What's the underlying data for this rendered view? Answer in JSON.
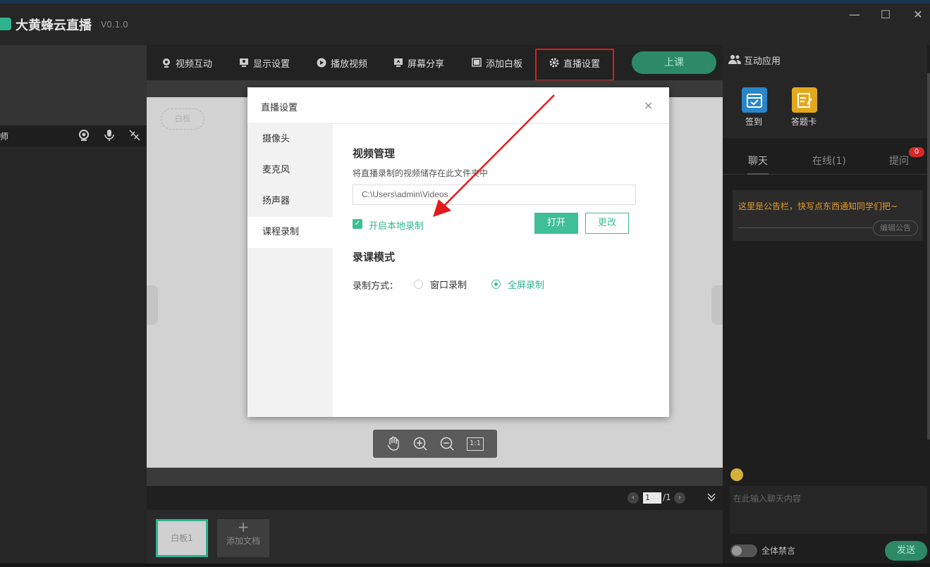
{
  "window": {
    "title": "大黄蜂云直播",
    "version": "V0.1.0",
    "minimize": "—",
    "maximize": "☐",
    "close": "✕"
  },
  "left_panel": {
    "teacher_label": "师"
  },
  "toolbar": {
    "video_interact": "视频互动",
    "display_settings": "显示设置",
    "play_video": "播放视频",
    "screen_share": "屏幕分享",
    "add_whiteboard": "添加白板",
    "live_settings": "直播设置",
    "start_class": "上课"
  },
  "canvas": {
    "whiteboard_tag": "白板",
    "zoom_fit": "1:1"
  },
  "pager": {
    "current": "1",
    "total": "/1"
  },
  "docs": {
    "whiteboard_thumb": "白板1",
    "add_doc_plus": "+",
    "add_doc": "添加文档"
  },
  "right_panel": {
    "apps_title": "互动应用",
    "apps": [
      {
        "label": "签到"
      },
      {
        "label": "答题卡"
      }
    ],
    "tabs": [
      {
        "label": "聊天"
      },
      {
        "label": "在线(1)"
      },
      {
        "label": "提问"
      }
    ],
    "question_badge": "0",
    "notice": "这里是公告栏，快写点东西通知同学们把~",
    "edit_notice": "编辑公告",
    "chat_placeholder": "在此输入聊天内容",
    "mute_all": "全体禁言",
    "send": "发送"
  },
  "modal": {
    "title": "直播设置",
    "close": "×",
    "nav": [
      {
        "label": "摄像头"
      },
      {
        "label": "麦克风"
      },
      {
        "label": "扬声器"
      },
      {
        "label": "课程录制"
      }
    ],
    "video_mgmt_title": "视频管理",
    "video_mgmt_desc": "将直播录制的视频储存在此文件夹中",
    "path_value": "C:\\Users\\admin\\Videos",
    "enable_local_record": "开启本地录制",
    "checkmark": "✓",
    "open_button": "打开",
    "change_button": "更改",
    "record_mode_title": "录课模式",
    "record_method_label": "录制方式：",
    "window_record": "窗口录制",
    "fullscreen_record": "全屏录制"
  },
  "colors": {
    "accent": "#3fbf95",
    "highlight": "#e21a1a",
    "notice": "#e59a2c"
  }
}
